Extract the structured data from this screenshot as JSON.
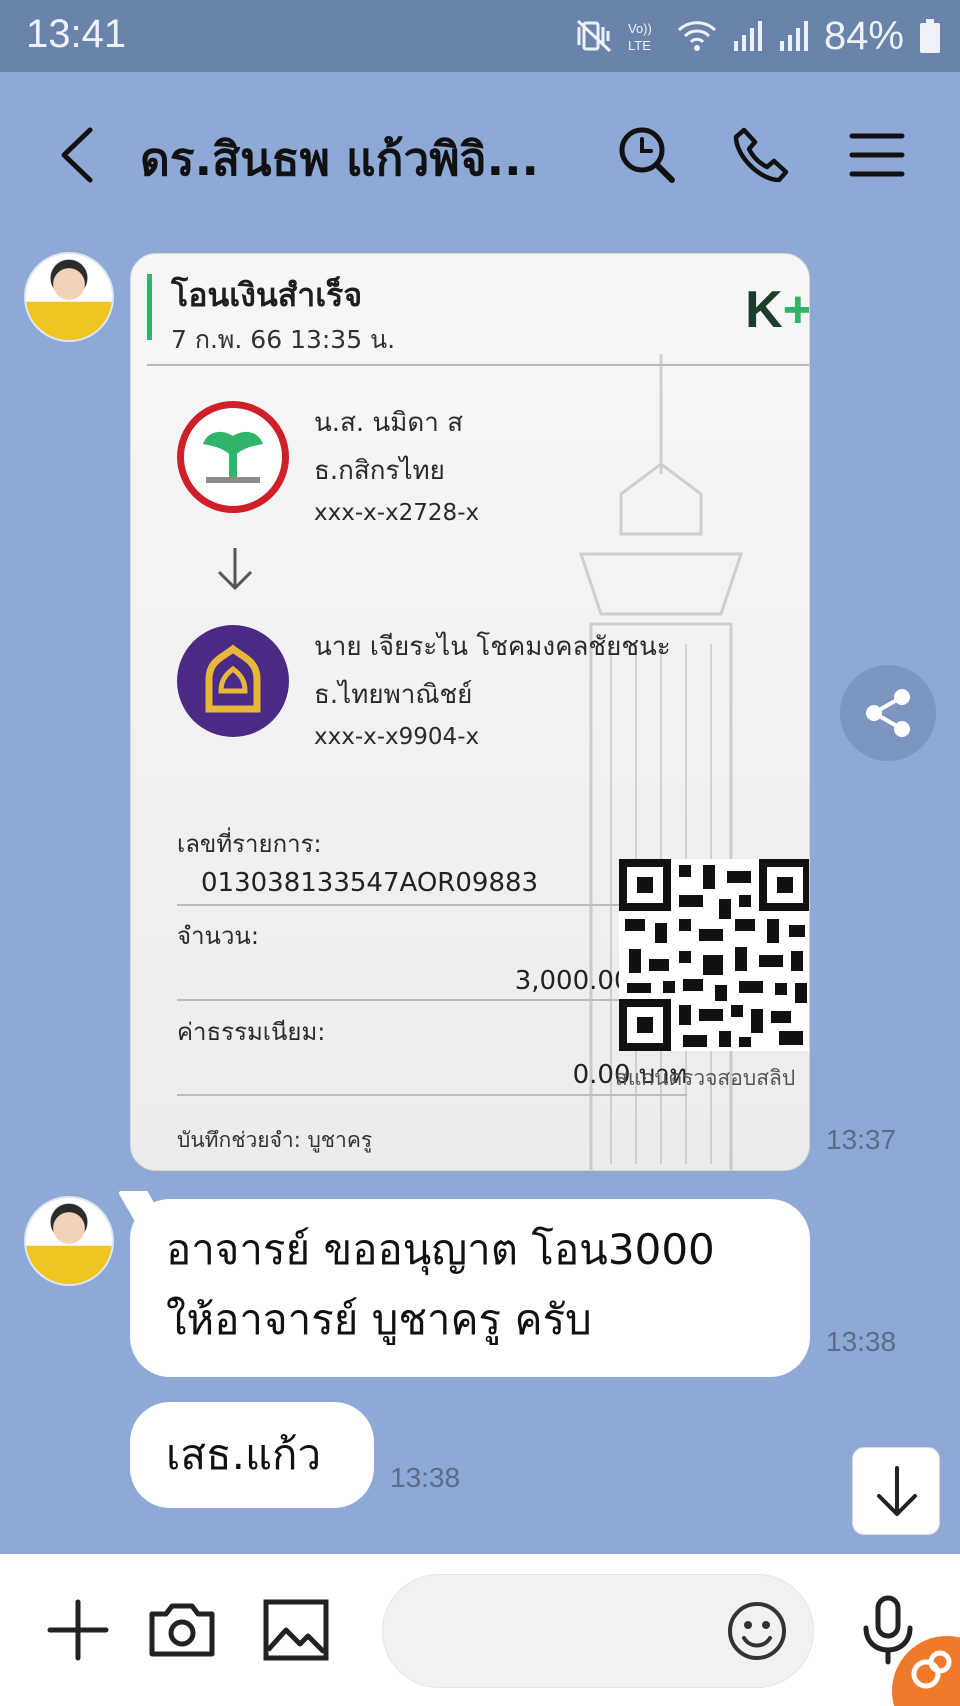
{
  "status_bar": {
    "time": "13:41",
    "battery_text": "84%",
    "icons": [
      "mute-vibrate-icon",
      "volte-icon",
      "wifi-icon",
      "signal-icon",
      "signal-icon",
      "battery-icon"
    ]
  },
  "header": {
    "title": "ดร.สินธพ แก้วพิจิ...",
    "icons": [
      "back-icon",
      "search-icon",
      "phone-icon",
      "menu-icon"
    ]
  },
  "messages": [
    {
      "type": "slip",
      "time": "13:37",
      "slip": {
        "title": "โอนเงินสำเร็จ",
        "datetime": "7 ก.พ. 66  13:35 น.",
        "brand": "K",
        "brand_plus": "+",
        "sender": {
          "name": "น.ส. นมิดา ส",
          "bank": "ธ.กสิกรไทย",
          "account": "xxx-x-x2728-x"
        },
        "receiver": {
          "name": "นาย เจียระไน โชคมงคลชัยชนะ",
          "bank": "ธ.ไทยพาณิชย์",
          "account": "xxx-x-x9904-x"
        },
        "ref_label": "เลขที่รายการ:",
        "ref_value": "013038133547AOR09883",
        "amount_label": "จำนวน:",
        "amount_value": "3,000.00 บาท",
        "fee_label": "ค่าธรรมเนียม:",
        "fee_value": "0.00 บาท",
        "memo": "บันทึกช่วยจำ: บูชาครู",
        "qr_caption": "สแกนตรวจสอบสลิป"
      }
    },
    {
      "type": "text",
      "time": "13:38",
      "lines": [
        "อาจารย์ ขออนุญาต โอน3000",
        "ให้อาจารย์ บูชาครู ครับ"
      ]
    },
    {
      "type": "text",
      "time": "13:38",
      "lines": [
        "เสธ.แก้ว"
      ]
    }
  ],
  "input_bar": {
    "placeholder": "",
    "icons": [
      "plus-icon",
      "camera-icon",
      "image-icon",
      "emoji-icon",
      "microphone-icon"
    ]
  },
  "colors": {
    "chat_background": "#8ea9d6",
    "status_bar": "#6a83ab",
    "kbank_green": "#2fb46a",
    "kbank_red": "#cf1f28",
    "scb_purple": "#4b2a86"
  }
}
